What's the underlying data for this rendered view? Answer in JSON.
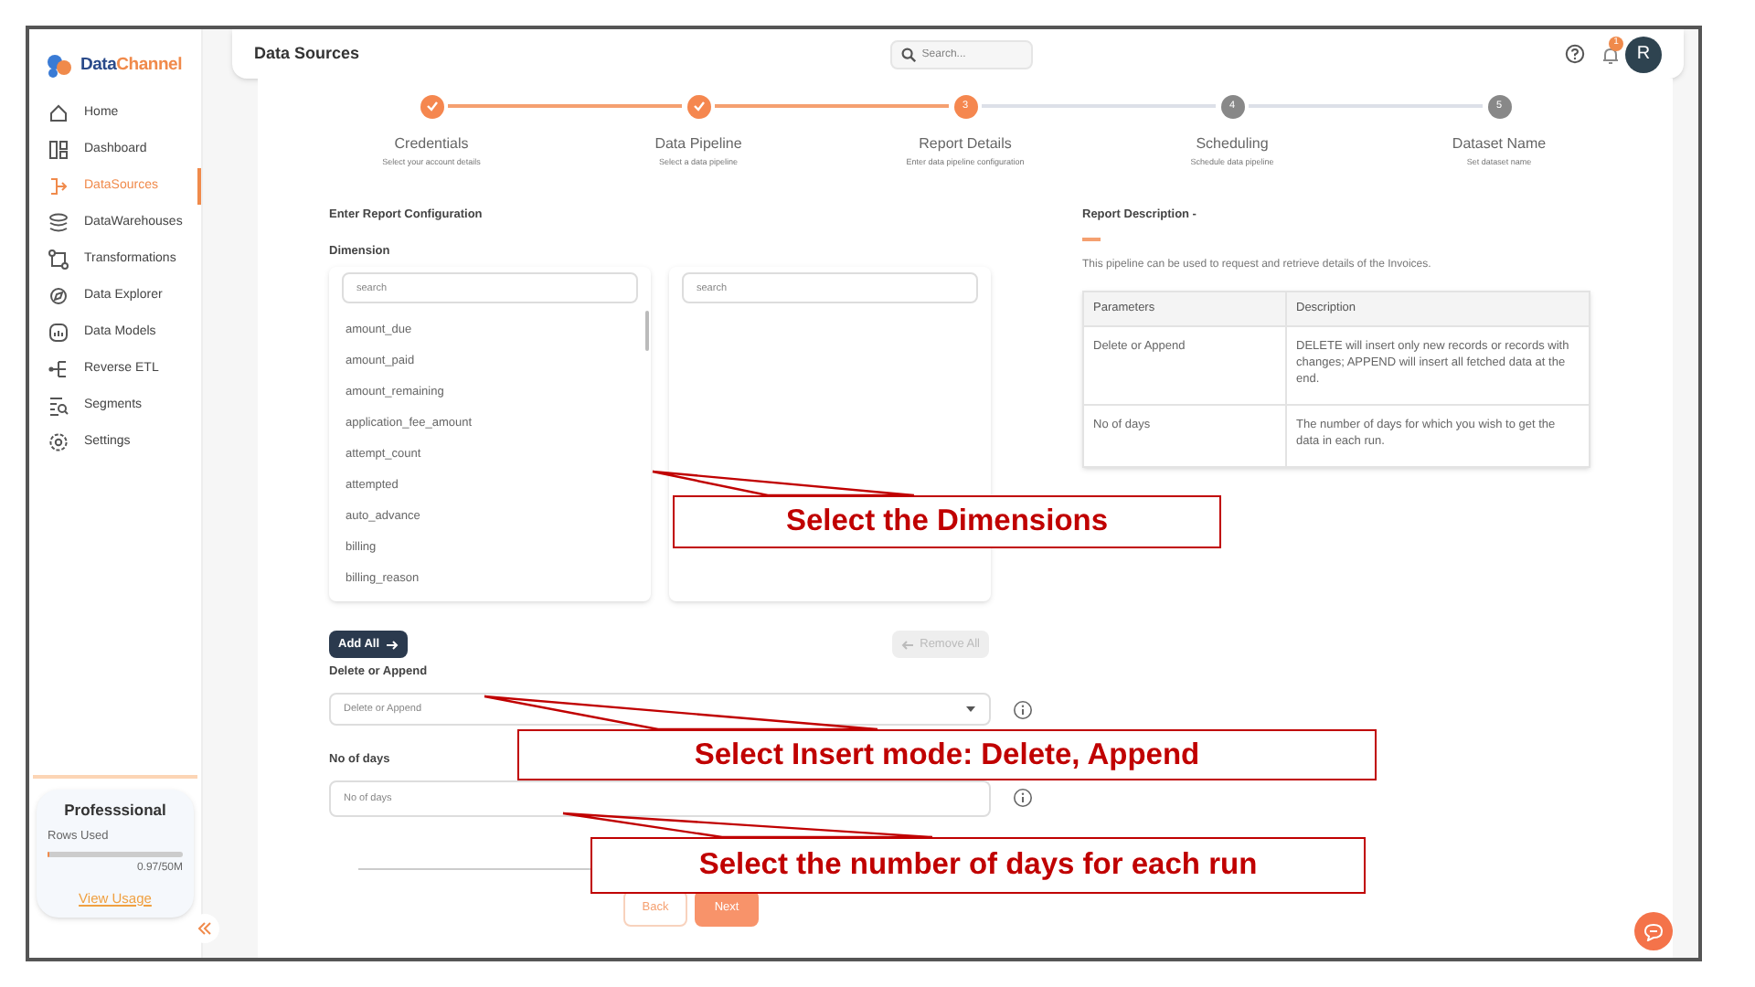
{
  "sidebar": {
    "logo_parts": [
      "Data",
      "Channel"
    ],
    "items": [
      {
        "label": "Home",
        "selected": false
      },
      {
        "label": "Dashboard",
        "selected": false
      },
      {
        "label": "DataSources",
        "selected": true
      },
      {
        "label": "DataWarehouses",
        "selected": false
      },
      {
        "label": "Transformations",
        "selected": false
      },
      {
        "label": "Data Explorer",
        "selected": false
      },
      {
        "label": "Data Models",
        "selected": false
      },
      {
        "label": "Reverse ETL",
        "selected": false
      },
      {
        "label": "Segments",
        "selected": false
      },
      {
        "label": "Settings",
        "selected": false
      }
    ],
    "plan": {
      "name": "Professsional",
      "usage_label": "Rows Used",
      "level": 0.02,
      "reading": "0.97/50M",
      "link": "View Usage"
    }
  },
  "header": {
    "title": "Data Sources",
    "search": {
      "placeholder": "Search..."
    },
    "notification_count": "1",
    "avatar": "R"
  },
  "steps": [
    {
      "label": "Credentials",
      "subtitle": "Select your account details",
      "selected": false
    },
    {
      "label": "Data Pipeline",
      "subtitle": "Select a data pipeline",
      "selected": false
    },
    {
      "label": "Report Details",
      "subtitle": "Enter data pipeline configuration",
      "selected": true,
      "number": "3"
    },
    {
      "label": "Scheduling",
      "subtitle": "Schedule data pipeline",
      "selected": false,
      "number": "4"
    },
    {
      "label": "Dataset Name",
      "subtitle": "Set dataset name",
      "selected": false,
      "number": "5"
    }
  ],
  "config": {
    "title": "Enter Report Configuration",
    "dimension_label": "Dimension",
    "available": {
      "search": {
        "placeholder": "search"
      },
      "items": [
        "amount_due",
        "amount_paid",
        "amount_remaining",
        "application_fee_amount",
        "attempt_count",
        "attempted",
        "auto_advance",
        "billing",
        "billing_reason"
      ]
    },
    "chosen": {
      "search": {
        "placeholder": "search"
      }
    },
    "add_all": {
      "label": "Add All",
      "disabled": false
    },
    "remove_all": {
      "label": "Remove All",
      "disabled": true
    },
    "fields": [
      {
        "label": "Delete or Append",
        "kind": "dropdown",
        "placeholder": "Delete or Append"
      },
      {
        "label": "No of days",
        "kind": "text",
        "placeholder": "No of days"
      }
    ]
  },
  "description": {
    "title": "Report Description -",
    "text": "This pipeline can be used to request and retrieve details of the Invoices.",
    "table": {
      "columns": [
        "Parameters",
        "Description"
      ],
      "rows": [
        [
          "Delete or Append",
          "DELETE will insert only new records or records with changes; APPEND will insert all fetched data at the end."
        ],
        [
          "No of days",
          "The number of days for which you wish to get the data in each run."
        ]
      ]
    }
  },
  "footer": {
    "back": "Back",
    "next": "Next"
  },
  "callouts": [
    {
      "text": "Select the Dimensions"
    },
    {
      "text": "Select Insert mode: Delete, Append"
    },
    {
      "text": "Select the number of days for each run"
    }
  ]
}
